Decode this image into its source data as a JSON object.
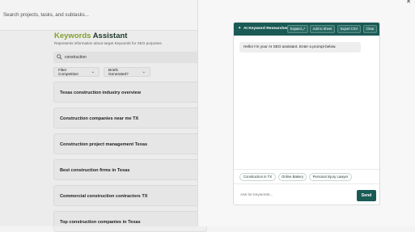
{
  "topbar": {
    "search_placeholder": "Search projects, tasks, and subtasks..."
  },
  "page": {
    "title_accent": "Keywords",
    "title_rest": " Assistant",
    "subtitle": "Represents information about target Keywords for SEO purposes.",
    "search_value": "construction"
  },
  "filters": {
    "competition": "Filter Competition",
    "briefs": "Briefs Generated?"
  },
  "keywords": [
    "Texas construction industry overview",
    "Construction companies near me TX",
    "Construction project management Texas",
    "Best construction firms in Texas",
    "Commercial construction contractors TX",
    "Top construction companies in Texas"
  ],
  "drawer": {
    "close_glyph": "✕"
  },
  "chat": {
    "title": "AI Keyword Researcher",
    "spark_glyph": "✦",
    "buttons": {
      "expand": "Expand ⤢",
      "add_to_sheet": "Add to Sheet",
      "export_csv": "Export CSV",
      "clear": "Clear"
    },
    "messages": [
      "Hello! I'm your AI SEO assistant. Enter a prompt below."
    ],
    "suggestions": [
      "Construction in TX",
      "Online Bakery",
      "Personal Injury Lawyer"
    ],
    "input_placeholder": "Ask for keywords...",
    "send_label": "Send"
  },
  "colors": {
    "accent_green": "#8aa630",
    "brand_dark_teal": "#1a5a55"
  }
}
